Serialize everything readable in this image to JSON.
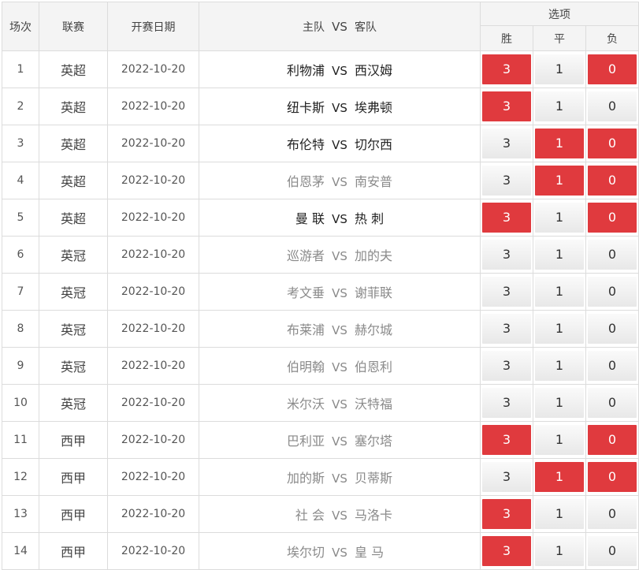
{
  "header": {
    "col_index": "场次",
    "col_league": "联赛",
    "col_date": "开赛日期",
    "col_home": "主队",
    "col_vs": "VS",
    "col_away": "客队",
    "col_options": "选项",
    "opt_win": "胜",
    "opt_draw": "平",
    "opt_lose": "负"
  },
  "colors": {
    "selected": "#e03a3e",
    "unselected": "#eeeeee"
  },
  "rows": [
    {
      "idx": "1",
      "league": "英超",
      "date": "2022-10-20",
      "home": "利物浦",
      "vs": "VS",
      "away": "西汉姆",
      "team_tone": "dark",
      "win": "3",
      "draw": "1",
      "lose": "0",
      "win_on": true,
      "draw_on": false,
      "lose_on": true
    },
    {
      "idx": "2",
      "league": "英超",
      "date": "2022-10-20",
      "home": "纽卡斯",
      "vs": "VS",
      "away": "埃弗顿",
      "team_tone": "dark",
      "win": "3",
      "draw": "1",
      "lose": "0",
      "win_on": true,
      "draw_on": false,
      "lose_on": false
    },
    {
      "idx": "3",
      "league": "英超",
      "date": "2022-10-20",
      "home": "布伦特",
      "vs": "VS",
      "away": "切尔西",
      "team_tone": "dark",
      "win": "3",
      "draw": "1",
      "lose": "0",
      "win_on": false,
      "draw_on": true,
      "lose_on": true
    },
    {
      "idx": "4",
      "league": "英超",
      "date": "2022-10-20",
      "home": "伯恩茅",
      "vs": "VS",
      "away": "南安普",
      "team_tone": "gray",
      "win": "3",
      "draw": "1",
      "lose": "0",
      "win_on": false,
      "draw_on": true,
      "lose_on": true
    },
    {
      "idx": "5",
      "league": "英超",
      "date": "2022-10-20",
      "home": "曼 联",
      "vs": "VS",
      "away": "热 刺",
      "team_tone": "dark",
      "win": "3",
      "draw": "1",
      "lose": "0",
      "win_on": true,
      "draw_on": false,
      "lose_on": true
    },
    {
      "idx": "6",
      "league": "英冠",
      "date": "2022-10-20",
      "home": "巡游者",
      "vs": "VS",
      "away": "加的夫",
      "team_tone": "gray",
      "win": "3",
      "draw": "1",
      "lose": "0",
      "win_on": false,
      "draw_on": false,
      "lose_on": false
    },
    {
      "idx": "7",
      "league": "英冠",
      "date": "2022-10-20",
      "home": "考文垂",
      "vs": "VS",
      "away": "谢菲联",
      "team_tone": "gray",
      "win": "3",
      "draw": "1",
      "lose": "0",
      "win_on": false,
      "draw_on": false,
      "lose_on": false
    },
    {
      "idx": "8",
      "league": "英冠",
      "date": "2022-10-20",
      "home": "布莱浦",
      "vs": "VS",
      "away": "赫尔城",
      "team_tone": "gray",
      "win": "3",
      "draw": "1",
      "lose": "0",
      "win_on": false,
      "draw_on": false,
      "lose_on": false
    },
    {
      "idx": "9",
      "league": "英冠",
      "date": "2022-10-20",
      "home": "伯明翰",
      "vs": "VS",
      "away": "伯恩利",
      "team_tone": "gray",
      "win": "3",
      "draw": "1",
      "lose": "0",
      "win_on": false,
      "draw_on": false,
      "lose_on": false
    },
    {
      "idx": "10",
      "league": "英冠",
      "date": "2022-10-20",
      "home": "米尔沃",
      "vs": "VS",
      "away": "沃特福",
      "team_tone": "gray",
      "win": "3",
      "draw": "1",
      "lose": "0",
      "win_on": false,
      "draw_on": false,
      "lose_on": false
    },
    {
      "idx": "11",
      "league": "西甲",
      "date": "2022-10-20",
      "home": "巴利亚",
      "vs": "VS",
      "away": "塞尔塔",
      "team_tone": "gray",
      "win": "3",
      "draw": "1",
      "lose": "0",
      "win_on": true,
      "draw_on": false,
      "lose_on": true
    },
    {
      "idx": "12",
      "league": "西甲",
      "date": "2022-10-20",
      "home": "加的斯",
      "vs": "VS",
      "away": "贝蒂斯",
      "team_tone": "gray",
      "win": "3",
      "draw": "1",
      "lose": "0",
      "win_on": false,
      "draw_on": true,
      "lose_on": true
    },
    {
      "idx": "13",
      "league": "西甲",
      "date": "2022-10-20",
      "home": "社 会",
      "vs": "VS",
      "away": "马洛卡",
      "team_tone": "gray",
      "win": "3",
      "draw": "1",
      "lose": "0",
      "win_on": true,
      "draw_on": false,
      "lose_on": false
    },
    {
      "idx": "14",
      "league": "西甲",
      "date": "2022-10-20",
      "home": "埃尔切",
      "vs": "VS",
      "away": "皇 马",
      "team_tone": "gray",
      "win": "3",
      "draw": "1",
      "lose": "0",
      "win_on": true,
      "draw_on": false,
      "lose_on": false
    }
  ]
}
